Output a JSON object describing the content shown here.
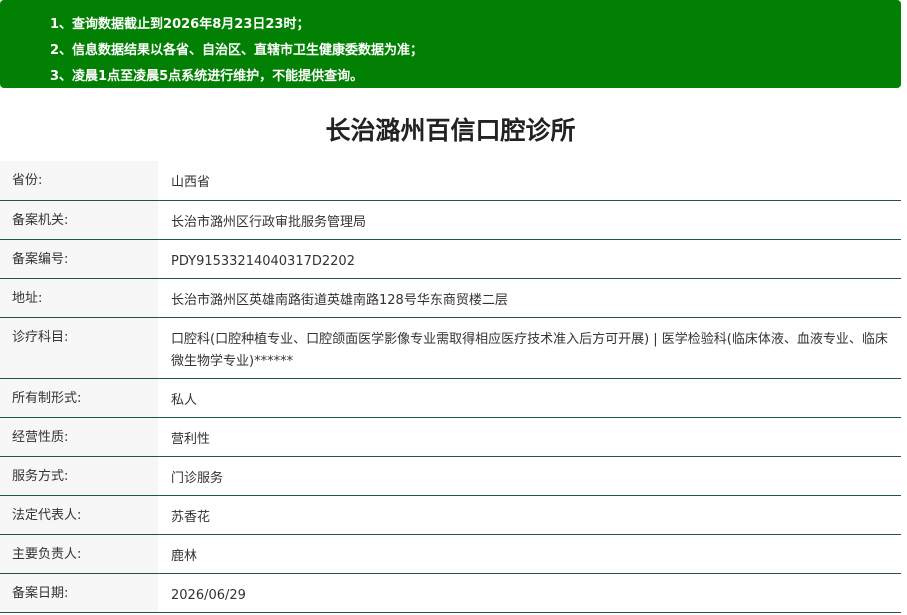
{
  "notice": {
    "lines": [
      {
        "num": "1、",
        "text": "查询数据截止到2026年8月23日23时；"
      },
      {
        "num": "2、",
        "text": "信息数据结果以各省、自治区、直辖市卫生健康委数据为准；"
      },
      {
        "num": "3、",
        "text": "凌晨1点至凌晨5点系统进行维护，不能提供查询。"
      }
    ],
    "color": "#028003"
  },
  "title": "长治潞州百信口腔诊所",
  "rows": [
    {
      "label": "省份:",
      "value": "山西省"
    },
    {
      "label": "备案机关:",
      "value": "长治市潞州区行政审批服务管理局"
    },
    {
      "label": "备案编号:",
      "value": "PDY91533214040317D2202"
    },
    {
      "label": "地址:",
      "value": "长治市潞州区英雄南路街道英雄南路128号华东商贸楼二层"
    },
    {
      "label": "诊疗科目:",
      "value": "口腔科(口腔种植专业、口腔颌面医学影像专业需取得相应医疗技术准入后方可开展) | 医学检验科(临床体液、血液专业、临床微生物学专业)******"
    },
    {
      "label": "所有制形式:",
      "value": "私人"
    },
    {
      "label": "经营性质:",
      "value": "营利性"
    },
    {
      "label": "服务方式:",
      "value": "门诊服务"
    },
    {
      "label": "法定代表人:",
      "value": "苏香花"
    },
    {
      "label": "主要负责人:",
      "value": "鹿林"
    },
    {
      "label": "备案日期:",
      "value": "2026/06/29"
    }
  ]
}
